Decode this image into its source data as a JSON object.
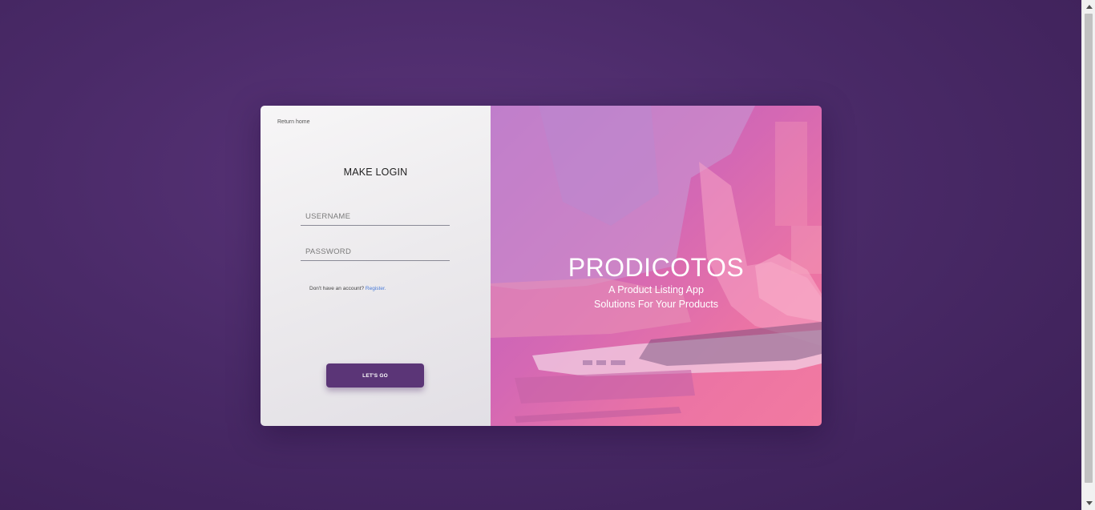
{
  "login": {
    "return_home": "Return home",
    "title": "MAKE LOGIN",
    "username_placeholder": "USERNAME",
    "password_placeholder": "PASSWORD",
    "register_prompt": "Don't have an account?",
    "register_link": "Register.",
    "submit_label": "LET'S GO"
  },
  "hero": {
    "title": "PRODICOTOS",
    "subtitle_line1": "A Product Listing App",
    "subtitle_line2": "Solutions For Your Products",
    "image_icon": "person-typing-on-laptop-photo"
  },
  "colors": {
    "accent": "#5b3577",
    "background": "#4a2a68",
    "hero_overlay": "#d468b4",
    "link": "#4a7bd8"
  }
}
